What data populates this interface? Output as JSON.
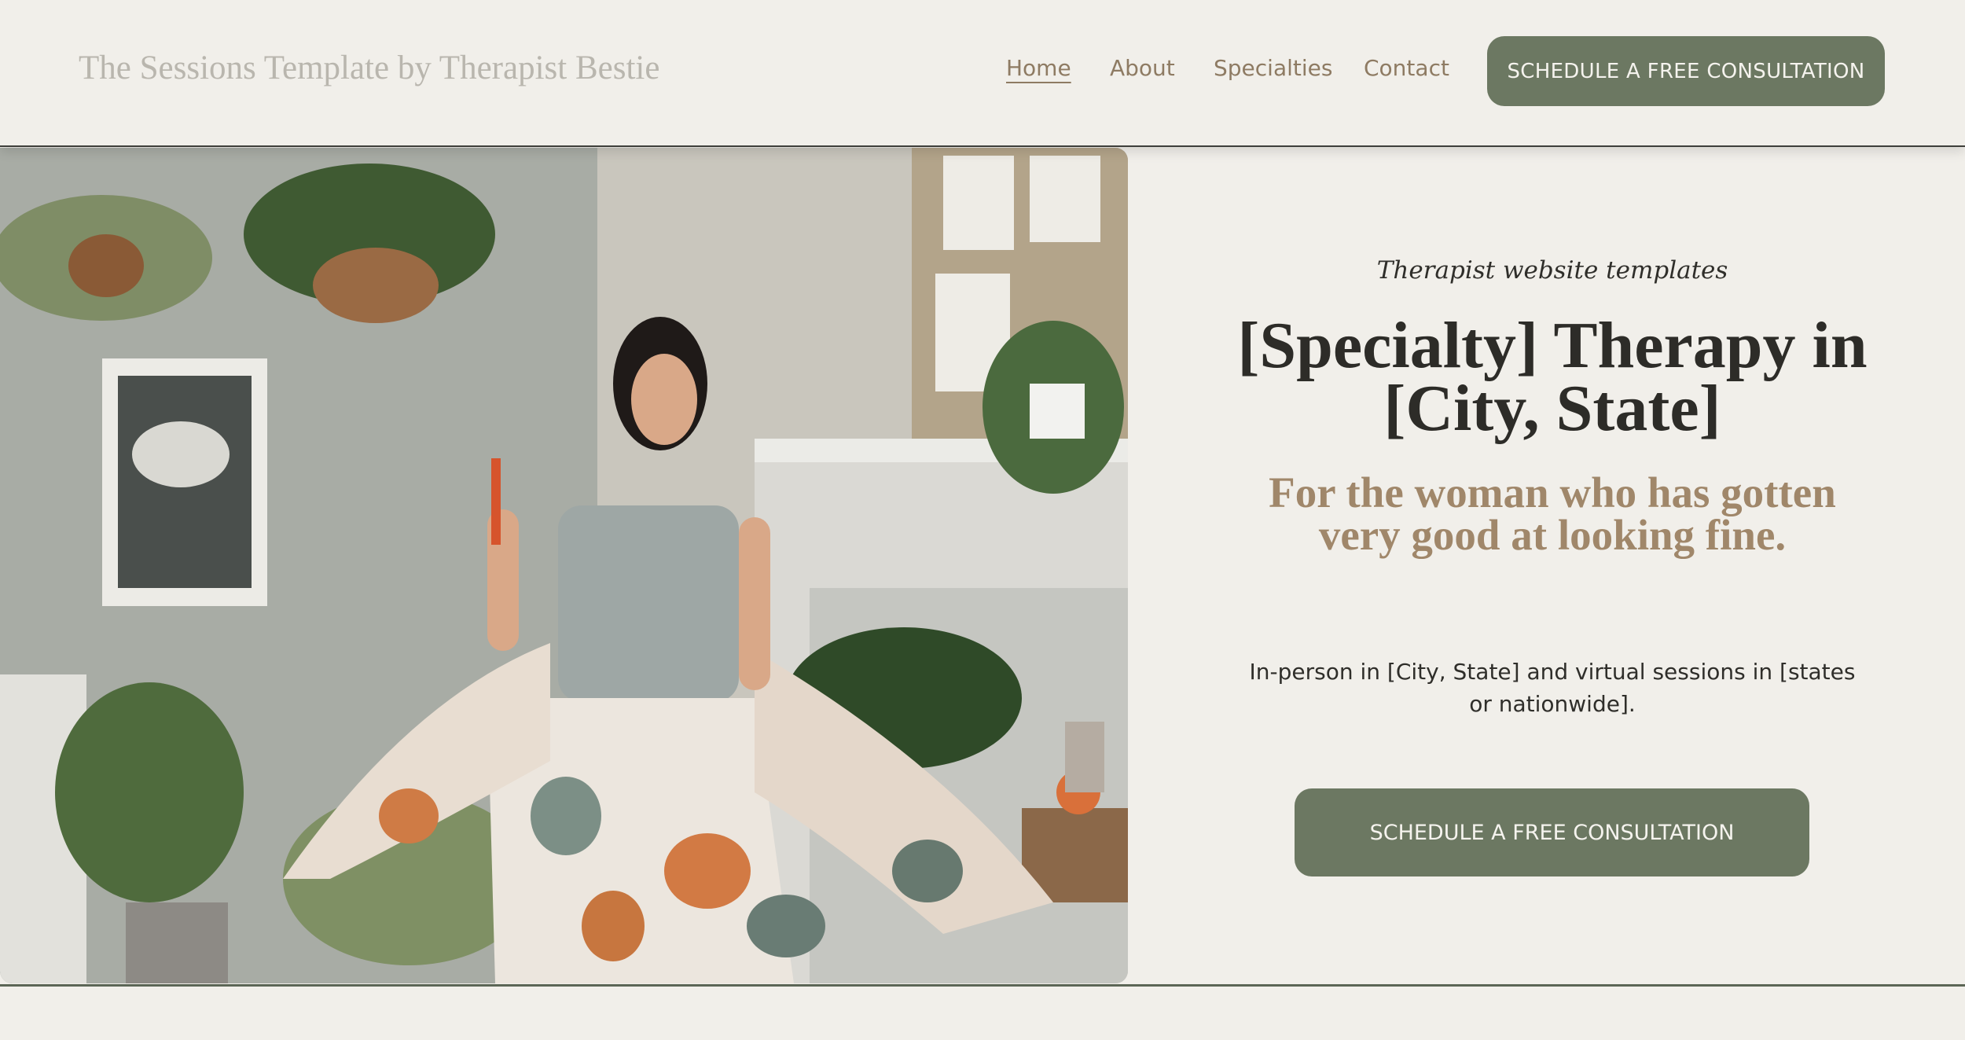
{
  "header": {
    "site_title": "The Sessions Template by Therapist Bestie",
    "nav": [
      {
        "label": "Home",
        "active": true
      },
      {
        "label": "About"
      },
      {
        "label": "Specialties"
      },
      {
        "label": "Contact"
      }
    ],
    "cta_label": "SCHEDULE A FREE CONSULTATION"
  },
  "hero": {
    "image_icon": "photo-woman-dancing",
    "eyebrow": "Therapist website templates",
    "headline": "[Specialty] Therapy in [City, State]",
    "subhead": "For the woman who has gotten very good at looking fine.",
    "body": "In-person in [City, State] and virtual sessions in [states or nationwide].",
    "cta_label": "SCHEDULE A FREE CONSULTATION"
  },
  "colors": {
    "background": "#f1efea",
    "accent_green": "#6c7862",
    "accent_brown": "#a0876a",
    "text_dark": "#2d2c28"
  }
}
